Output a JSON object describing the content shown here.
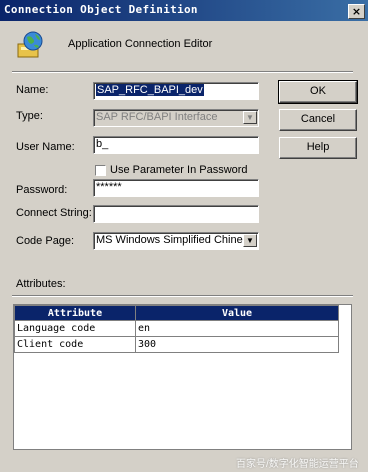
{
  "window": {
    "title": "Connection Object Definition",
    "close_glyph": "×"
  },
  "header": {
    "icon": "connection-globe-icon",
    "subtitle": "Application Connection Editor"
  },
  "form": {
    "name_label": "Name:",
    "name_value": "SAP_RFC_BAPI_dev",
    "type_label": "Type:",
    "type_value": "SAP RFC/BAPI Interface",
    "username_label": "User Name:",
    "username_value": "b_",
    "use_param_label": "Use Parameter In Password",
    "password_label": "Password:",
    "password_value": "******",
    "connect_label": "Connect String:",
    "connect_value": "",
    "codepage_label": "Code Page:",
    "codepage_value": "MS Windows Simplified Chinese, s",
    "attributes_label": "Attributes:"
  },
  "buttons": {
    "ok": "OK",
    "cancel": "Cancel",
    "help": "Help"
  },
  "attributes_table": {
    "columns": [
      "Attribute",
      "Value"
    ],
    "rows": [
      {
        "attribute": "Language code",
        "value": "en"
      },
      {
        "attribute": "Client code",
        "value": "300"
      }
    ]
  },
  "watermark": "百家号/数字化智能运营平台",
  "colors": {
    "title_bar": "#0a246a",
    "face": "#d4d0c8",
    "selection": "#0a246a"
  }
}
